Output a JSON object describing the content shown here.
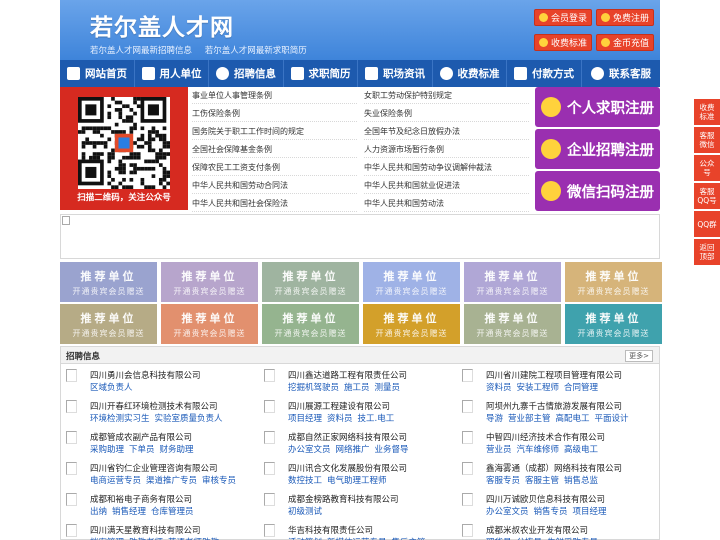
{
  "header": {
    "title": "若尔盖人才网",
    "subtitle_links": [
      "若尔盖人才网最新招聘信息",
      "若尔盖人才网最新求职简历"
    ],
    "buttons": [
      "会员登录",
      "免费注册",
      "收费标准",
      "金币充值"
    ]
  },
  "nav": {
    "items": [
      {
        "label": "网站首页",
        "icon": "home-icon"
      },
      {
        "label": "用人单位",
        "icon": "building-icon"
      },
      {
        "label": "招聘信息",
        "icon": "megaphone-icon"
      },
      {
        "label": "求职简历",
        "icon": "resume-icon"
      },
      {
        "label": "职场资讯",
        "icon": "news-icon"
      },
      {
        "label": "收费标准",
        "icon": "price-icon"
      },
      {
        "label": "付款方式",
        "icon": "card-icon"
      },
      {
        "label": "联系客服",
        "icon": "phone-icon"
      }
    ]
  },
  "qr": {
    "caption": "扫描二维码，关注公众号"
  },
  "laws": {
    "left": [
      "事业单位人事管理条例",
      "工伤保险条例",
      "国务院关于职工工作时间的规定",
      "全国社会保障基金条例",
      "保障农民工工资支付条例",
      "中华人民共和国劳动合同法",
      "中华人民共和国社会保险法"
    ],
    "right": [
      "女职工劳动保护特别规定",
      "失业保险条例",
      "全国年节及纪念日放假办法",
      "人力资源市场暂行条例",
      "中华人民共和国劳动争议调解仲裁法",
      "中华人民共和国就业促进法",
      "中华人民共和国劳动法"
    ]
  },
  "register": [
    "个人求职注册",
    "企业招聘注册",
    "微信扫码注册"
  ],
  "recommend": {
    "title": "推荐单位",
    "sub": "开通贵宾会员赠送",
    "colors": [
      "#9aa3cf",
      "#b7a5cc",
      "#9fb4a0",
      "#9fb2e6",
      "#b0a7d6",
      "#d6b47a",
      "#b6ab86",
      "#e2906e",
      "#95b48f",
      "#d3a02a",
      "#a8b292",
      "#3fa2ad"
    ]
  },
  "jobs": {
    "title": "招聘信息",
    "more": "更多>",
    "columns": [
      [
        {
          "company": "四川勇川会信息科技有限公司",
          "positions": [
            "区域负责人"
          ]
        },
        {
          "company": "四川开春红环境检测技术有限公司",
          "positions": [
            "环境检测实习生",
            "实验室质量负责人"
          ]
        },
        {
          "company": "成都管成农副产品有限公司",
          "positions": [
            "采购助理",
            "下单员",
            "财务助理"
          ]
        },
        {
          "company": "四川省钓仁企业管理咨询有限公司",
          "positions": [
            "电商运营专员",
            "渠道推广专员",
            "审核专员"
          ]
        },
        {
          "company": "成都和裕电子商务有限公司",
          "positions": [
            "出纳",
            "销售经理",
            "仓库管理员"
          ]
        },
        {
          "company": "四川满天星教育科技有限公司",
          "positions": [
            "档案管理",
            "助教老师",
            "英语老师助教"
          ]
        }
      ],
      [
        {
          "company": "四川鑫达道路工程有限责任公司",
          "positions": [
            "挖掘机驾驶员",
            "施工员",
            "测量员"
          ]
        },
        {
          "company": "四川展源工程建设有限公司",
          "positions": [
            "项目经理",
            "资料员",
            "技工.电工"
          ]
        },
        {
          "company": "成都自然正家网络科技有限公司",
          "positions": [
            "办公室文员",
            "网络推广",
            "业务督导"
          ]
        },
        {
          "company": "四川讯合文化发展股份有限公司",
          "positions": [
            "数控技工",
            "电气助理工程师"
          ]
        },
        {
          "company": "成都金榜路教育科技有限公司",
          "positions": [
            "初级测试"
          ]
        },
        {
          "company": "华吉科技有限责任公司",
          "positions": [
            "活动策划",
            "新媒体运营专员",
            "售后主管"
          ]
        }
      ],
      [
        {
          "company": "四川省川建院工程项目管理有限公司",
          "positions": [
            "资料员",
            "安装工程师",
            "合同管理"
          ]
        },
        {
          "company": "阿坝州九寨千古情旅游发展有限公司",
          "positions": [
            "导游",
            "营业部主管",
            "高配电工",
            "平面设计"
          ]
        },
        {
          "company": "中智四川经济技术合作有限公司",
          "positions": [
            "营业员",
            "汽车维修师",
            "高级电工"
          ]
        },
        {
          "company": "鑫海雾通（成都）网络科技有限公司",
          "positions": [
            "客服专员",
            "客服主管",
            "销售总监"
          ]
        },
        {
          "company": "四川万诚欧贝信息科技有限公司",
          "positions": [
            "办公室文员",
            "销售专员",
            "项目经理"
          ]
        },
        {
          "company": "成都米叔农业开发有限公司",
          "positions": [
            "理货员",
            "分拣员",
            "生鲜采购专员"
          ]
        }
      ]
    ]
  },
  "side": [
    "收费标准",
    "客服微信",
    "公众号",
    "客服QQ号",
    "QQ群",
    "返回顶部"
  ]
}
